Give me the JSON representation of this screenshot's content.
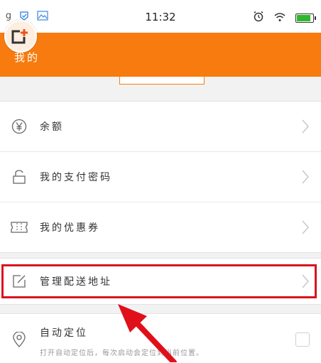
{
  "status_bar": {
    "time": "11:32",
    "left_text": "g"
  },
  "header": {
    "title": "我的"
  },
  "menu_group_1": [
    {
      "label": "余额",
      "icon": "yen-icon"
    },
    {
      "label": "我的支付密码",
      "icon": "lock-icon"
    },
    {
      "label": "我的优惠券",
      "icon": "ticket-icon"
    }
  ],
  "menu_group_2": [
    {
      "label": "管理配送地址",
      "icon": "edit-icon"
    }
  ],
  "auto_location": {
    "title": "自动定位",
    "description": "打开自动定位后，每次启动会定位到当前位置。",
    "checked": false
  },
  "colors": {
    "accent": "#f77b0f",
    "highlight": "#d8141f"
  }
}
